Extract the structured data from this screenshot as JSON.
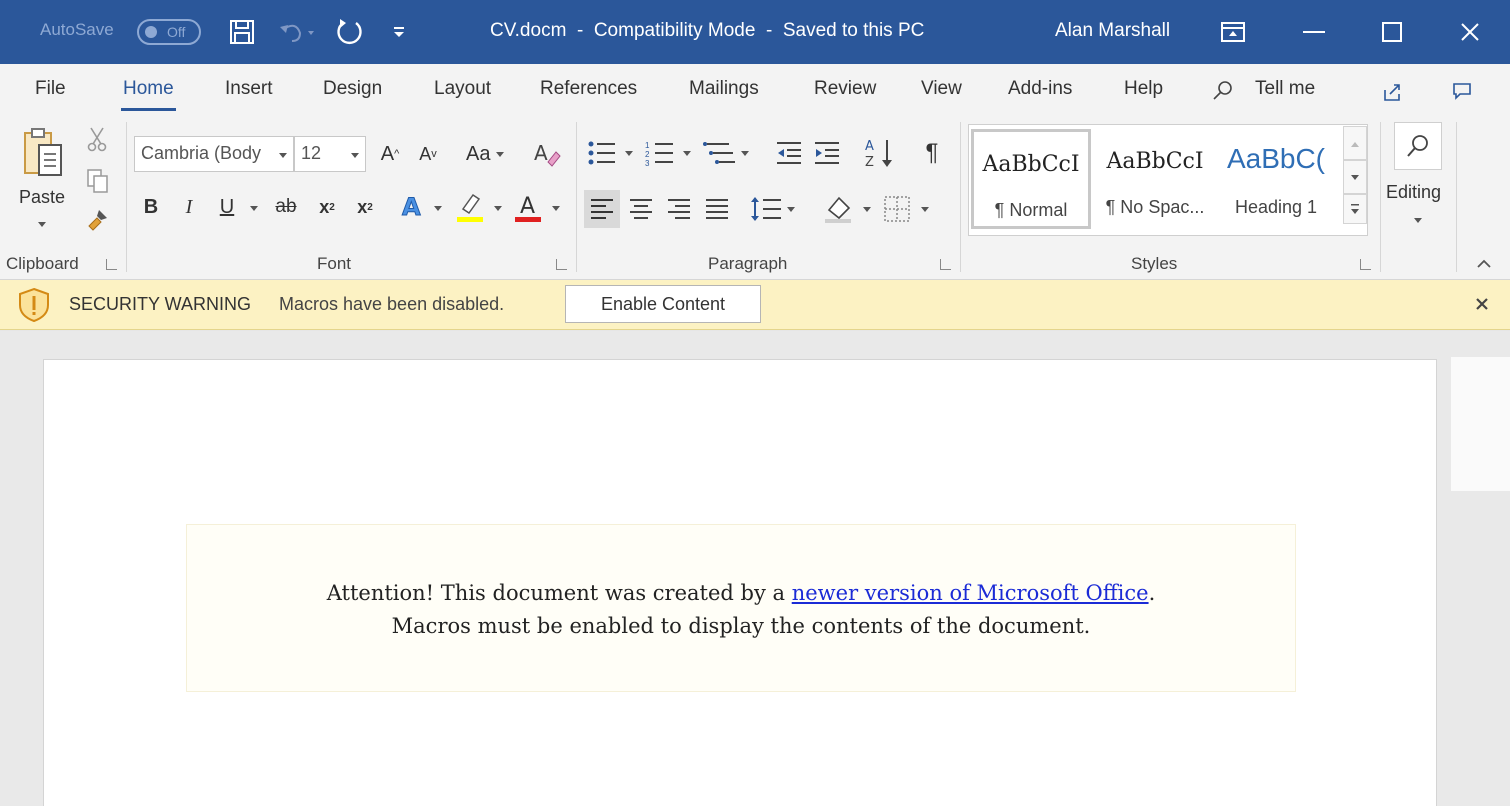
{
  "titlebar": {
    "autosave_label": "AutoSave",
    "autosave_state": "Off",
    "title": "CV.docm  -  Compatibility Mode  -  Saved to this PC",
    "user": "Alan Marshall",
    "bg_color": "#2b579a"
  },
  "tabs": [
    {
      "label": "File"
    },
    {
      "label": "Home",
      "active": true
    },
    {
      "label": "Insert"
    },
    {
      "label": "Design"
    },
    {
      "label": "Layout"
    },
    {
      "label": "References"
    },
    {
      "label": "Mailings"
    },
    {
      "label": "Review"
    },
    {
      "label": "View"
    },
    {
      "label": "Add-ins"
    },
    {
      "label": "Help"
    }
  ],
  "tell_me": "Tell me",
  "ribbon": {
    "clipboard": {
      "paste_label": "Paste",
      "group_label": "Clipboard"
    },
    "font": {
      "font_name": "Cambria (Body",
      "font_size": "12",
      "change_case_label": "Aa",
      "bold": "B",
      "italic": "I",
      "underline": "U",
      "strike": "ab",
      "group_label": "Font"
    },
    "paragraph": {
      "group_label": "Paragraph"
    },
    "styles": {
      "items": [
        {
          "sample": "AaBbCcI",
          "name": "¶ Normal"
        },
        {
          "sample": "AaBbCcI",
          "name": "¶ No Spac..."
        },
        {
          "sample": "AaBbC(",
          "name": "Heading 1"
        }
      ],
      "group_label": "Styles"
    },
    "editing": {
      "label": "Editing"
    }
  },
  "security_bar": {
    "title": "SECURITY WARNING",
    "message": "Macros have been disabled.",
    "button_label": "Enable Content",
    "bg_color": "#fcf2c3"
  },
  "document": {
    "line1_before": "Attention! This document was created by a ",
    "line1_link": "newer version of Microsoft Office",
    "line1_after": ".",
    "line2": "Macros must be enabled to display the contents of the document."
  }
}
